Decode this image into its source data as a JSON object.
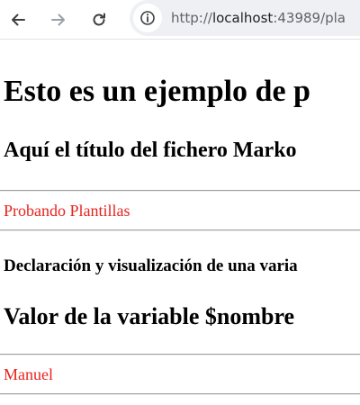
{
  "browser": {
    "url_scheme": "http://",
    "url_host": "localhost",
    "url_rest": ":43989/pla",
    "icons": {
      "back": "arrow-left-icon",
      "forward": "arrow-right-icon",
      "reload": "reload-icon",
      "site_info": "tune-icon"
    }
  },
  "page": {
    "heading": "Esto es un ejemplo de p",
    "markdown_title": "Aquí el título del fichero Marko",
    "first_value": "Probando Plantillas",
    "section_heading": "Declaración y visualización de una varia",
    "variable_heading": "Valor de la variable $nombre",
    "second_value": "Manuel"
  },
  "colors": {
    "value_text": "#e8221b",
    "rule": "#9e9e9e"
  }
}
